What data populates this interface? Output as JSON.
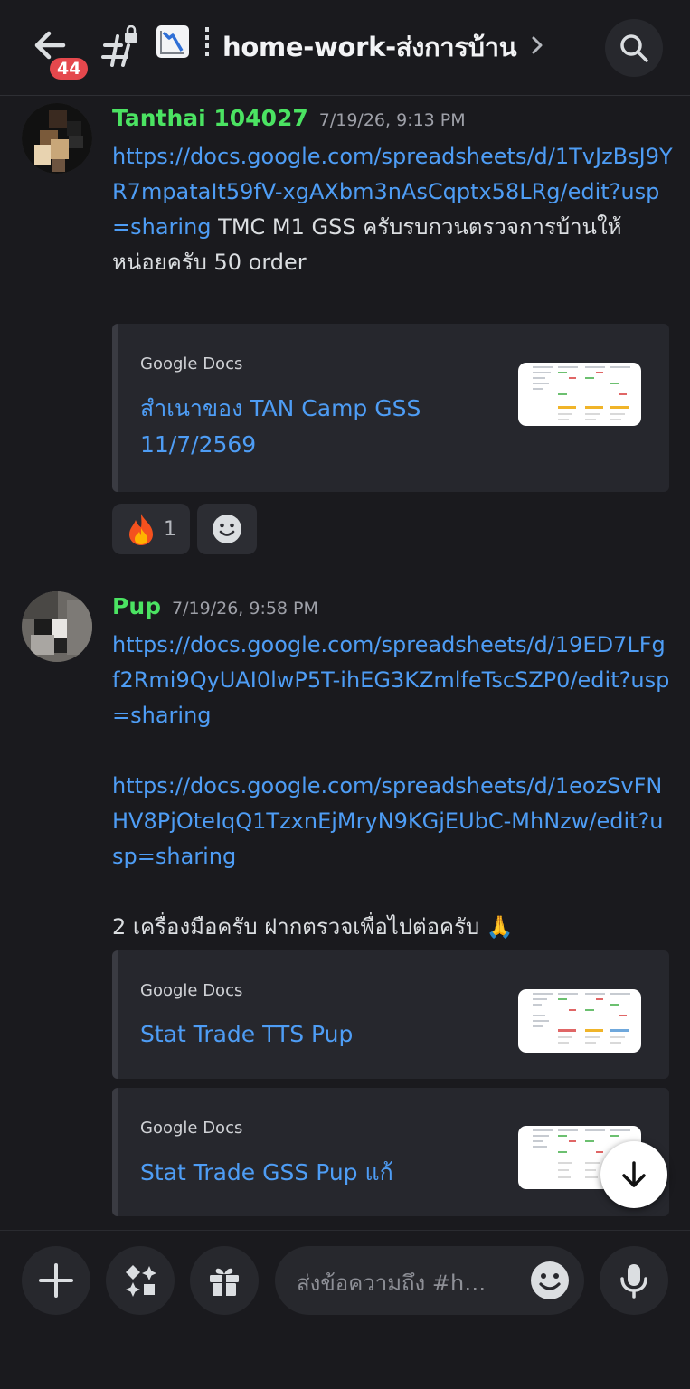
{
  "header": {
    "unread_badge": "44",
    "channel_name": "home-work-ส่งการบ้าน",
    "channel_emoji": "chart-decreasing-icon"
  },
  "messages": [
    {
      "author": "Tanthai 104027",
      "timestamp": "7/19/26, 9:13 PM",
      "link": "https://docs.google.com/spreadsheets/d/1TvJzBsJ9YR7mpataIt59fV-xgAXbm3nAsCqptx58LRg/edit?usp=sharing",
      "text": "TMC M1 GSS ครับรบกวนตรวจการบ้านให้หน่อยครับ 50 order",
      "embed": {
        "provider": "Google Docs",
        "title": "สำเนาของ TAN Camp  GSS 11/7/2569"
      },
      "reactions": [
        {
          "emoji": "🔥",
          "count": "1"
        }
      ]
    },
    {
      "author": "Pup",
      "timestamp": "7/19/26, 9:58 PM",
      "link_1": "https://docs.google.com/spreadsheets/d/19ED7LFgf2Rmi9QyUAI0lwP5T-ihEG3KZmlfeTscSZP0/edit?usp=sharing",
      "link_2": "https://docs.google.com/spreadsheets/d/1eozSvFNHV8PjOteIqQ1TzxnEjMryN9KGjEUbC-MhNzw/edit?usp=sharing",
      "text": "2 เครื่องมือครับ ฝากตรวจเพื่อไปต่อครับ 🙏",
      "embeds": [
        {
          "provider": "Google Docs",
          "title": "Stat Trade TTS Pup"
        },
        {
          "provider": "Google Docs",
          "title": "Stat Trade GSS Pup แก้"
        }
      ]
    }
  ],
  "composer": {
    "placeholder": "ส่งข้อความถึง #home-work-ส่งการบ้าน"
  },
  "colors": {
    "background": "#1a1a1e",
    "author_green": "#4be362",
    "link_blue": "#4e9df5",
    "badge_red": "#e5484d"
  }
}
